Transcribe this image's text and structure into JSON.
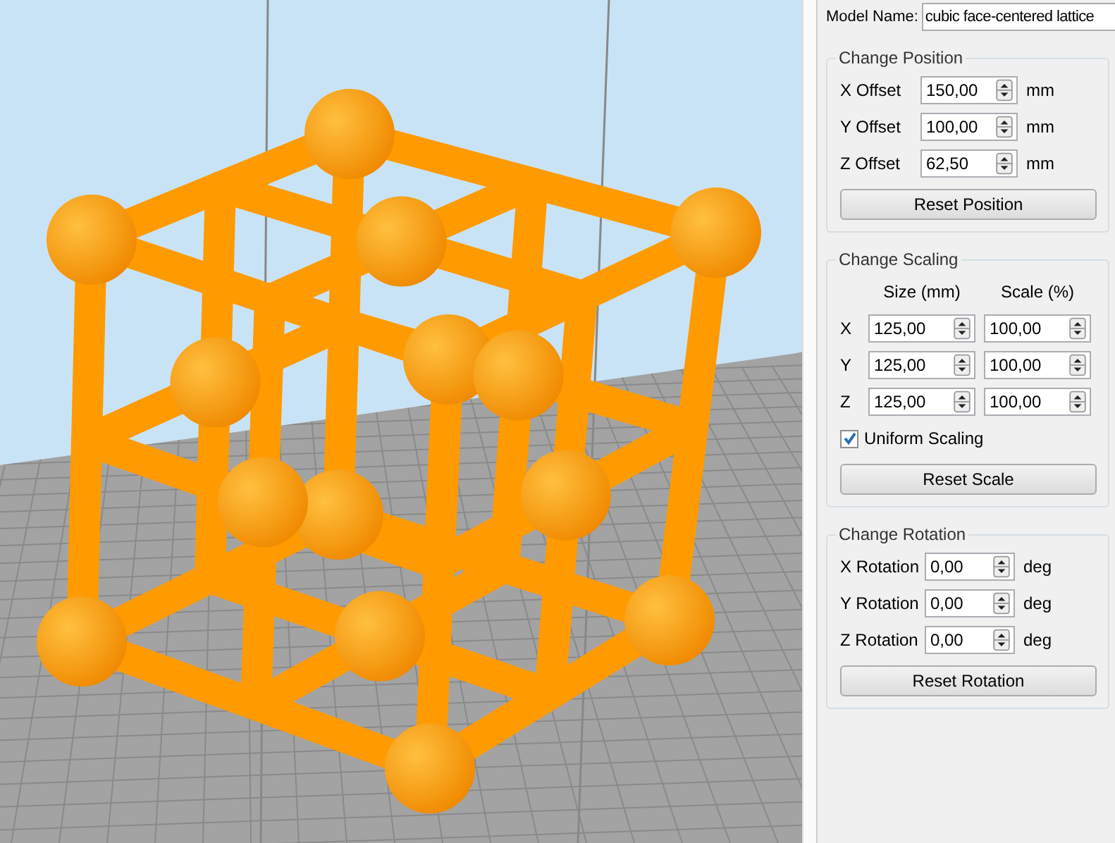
{
  "model_name": {
    "label": "Model Name:",
    "value": "cubic face-centered lattice"
  },
  "position": {
    "title": "Change Position",
    "rows": [
      {
        "label": "X Offset",
        "value": "150,00",
        "unit": "mm"
      },
      {
        "label": "Y Offset",
        "value": "100,00",
        "unit": "mm"
      },
      {
        "label": "Z Offset",
        "value": "62,50",
        "unit": "mm"
      }
    ],
    "button": "Reset Position"
  },
  "scaling": {
    "title": "Change Scaling",
    "columns": [
      "Size (mm)",
      "Scale (%)"
    ],
    "rows": [
      {
        "label": "X",
        "size": "125,00",
        "scale": "100,00"
      },
      {
        "label": "Y",
        "size": "125,00",
        "scale": "100,00"
      },
      {
        "label": "Z",
        "size": "125,00",
        "scale": "100,00"
      }
    ],
    "uniform": {
      "label": "Uniform Scaling",
      "checked": true
    },
    "button": "Reset Scale"
  },
  "rotation": {
    "title": "Change Rotation",
    "rows": [
      {
        "label": "X Rotation",
        "value": "0,00",
        "unit": "deg"
      },
      {
        "label": "Y Rotation",
        "value": "0,00",
        "unit": "deg"
      },
      {
        "label": "Z Rotation",
        "value": "0,00",
        "unit": "deg"
      }
    ],
    "button": "Reset Rotation"
  }
}
